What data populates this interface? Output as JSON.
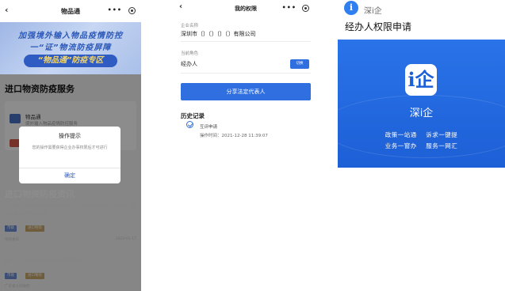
{
  "panel1": {
    "nav": {
      "back_icon": "‹",
      "title": "物品通",
      "more": "•••"
    },
    "banner": {
      "line1": "加强境外输入物品疫情防控",
      "line2": "一“证”物流防疫屏障",
      "line3": "“物品通”防疫专区"
    },
    "section_title": "进口物资防疫服务",
    "card": {
      "title": "物品通",
      "subtitle": "境外输入物品疫情防控服务"
    },
    "dialog": {
      "title": "操作提示",
      "message": "您的操作需要获得企业办事权限后才可进行",
      "confirm": "确定"
    },
    "section2_title": "进口物资防疫资讯",
    "news1": {
      "title": "王伟中主持市委常委会会议持续用力提高防控科学性精准性 坚决阻断病毒传播链条",
      "tag1": "市级",
      "tag2": "进口物资",
      "meta": "深圳发布",
      "date": "2022-01-17"
    },
    "news2": {
      "title": "致广大企业家关于疫情防控的提醒函",
      "tag1": "市级",
      "tag2": "进口物资",
      "meta": "广东省人民政府"
    }
  },
  "panel2": {
    "nav": {
      "back_icon": "‹",
      "title": "我的权限",
      "more": "•••"
    },
    "company_label": "企业名称",
    "company_value": "深圳市〔〕〔〕〔〕〔〕有限公司",
    "role_label": "当前角色",
    "role_value": "经办人",
    "switch_button": "切换",
    "share_button": "分享法定代表人",
    "history_title": "历史记录",
    "record_status": "互评申请",
    "record_time": "操作时间：2021-12-28 11:39:07"
  },
  "panel3": {
    "logo_char": "i",
    "app_name": "深i企",
    "page_title": "经办人权限申请",
    "card": {
      "icon_char": "i企",
      "brand": "深i企",
      "row1_left": "政策一站通",
      "row1_right": "诉求一键提",
      "row2_left": "业务一窗办",
      "row2_right": "服务一网汇"
    }
  },
  "colors": {
    "primary_blue": "#2f6fe0",
    "deep_blue": "#1d5fd6",
    "banner_gold": "#f4d66a"
  }
}
